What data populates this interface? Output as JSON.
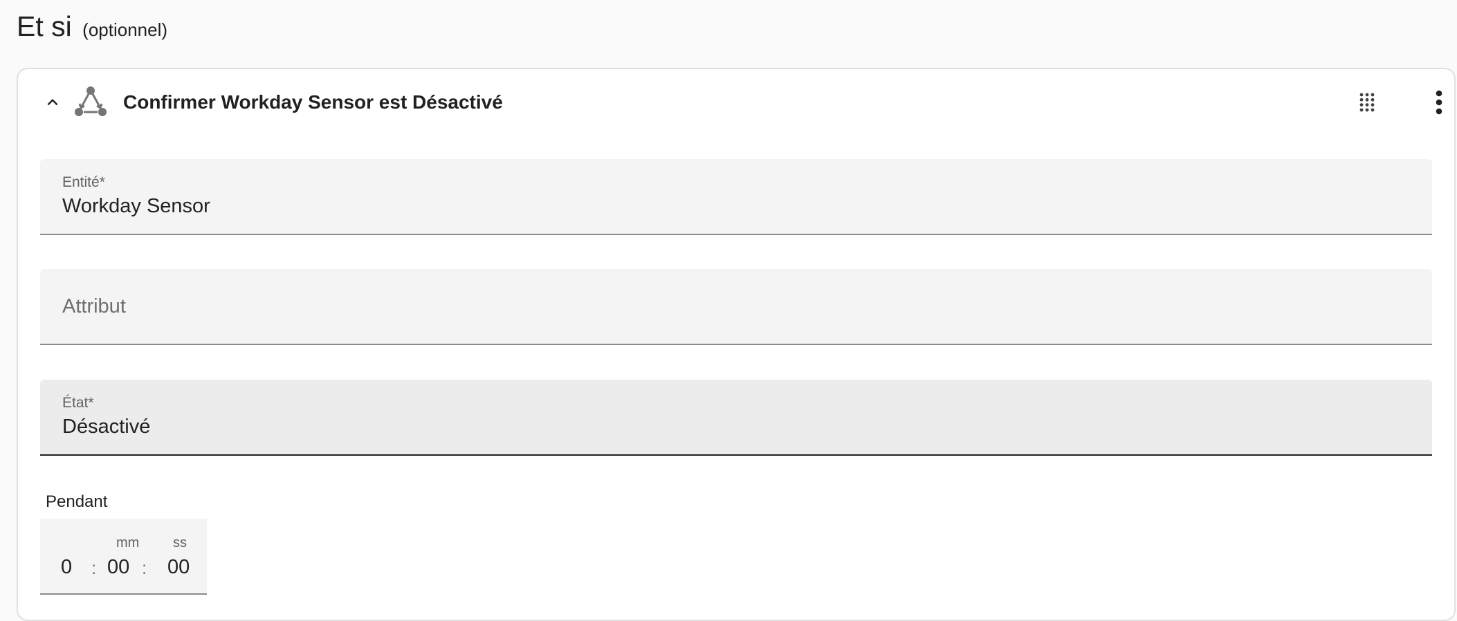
{
  "section": {
    "title": "Et si",
    "optional": "(optionnel)"
  },
  "condition": {
    "title": "Confirmer Workday Sensor est Désactivé",
    "icons": {
      "collapse": "chevron-up-icon",
      "type": "state-condition-icon",
      "drag": "drag-handle-icon",
      "menu": "more-vertical-icon"
    }
  },
  "fields": {
    "entity": {
      "label": "Entité*",
      "value": "Workday Sensor"
    },
    "attribute": {
      "placeholder": "Attribut"
    },
    "state": {
      "label": "État*",
      "value": "Désactivé"
    }
  },
  "duration": {
    "label": "Pendant",
    "minutes_label": "mm",
    "seconds_label": "ss",
    "hours": "0",
    "minutes": "00",
    "seconds": "00",
    "separator": ":"
  },
  "colors": {
    "text": "#212121",
    "field_bg": "#f4f4f4",
    "field_focused_bg": "#ececec",
    "icon": "#757575"
  }
}
